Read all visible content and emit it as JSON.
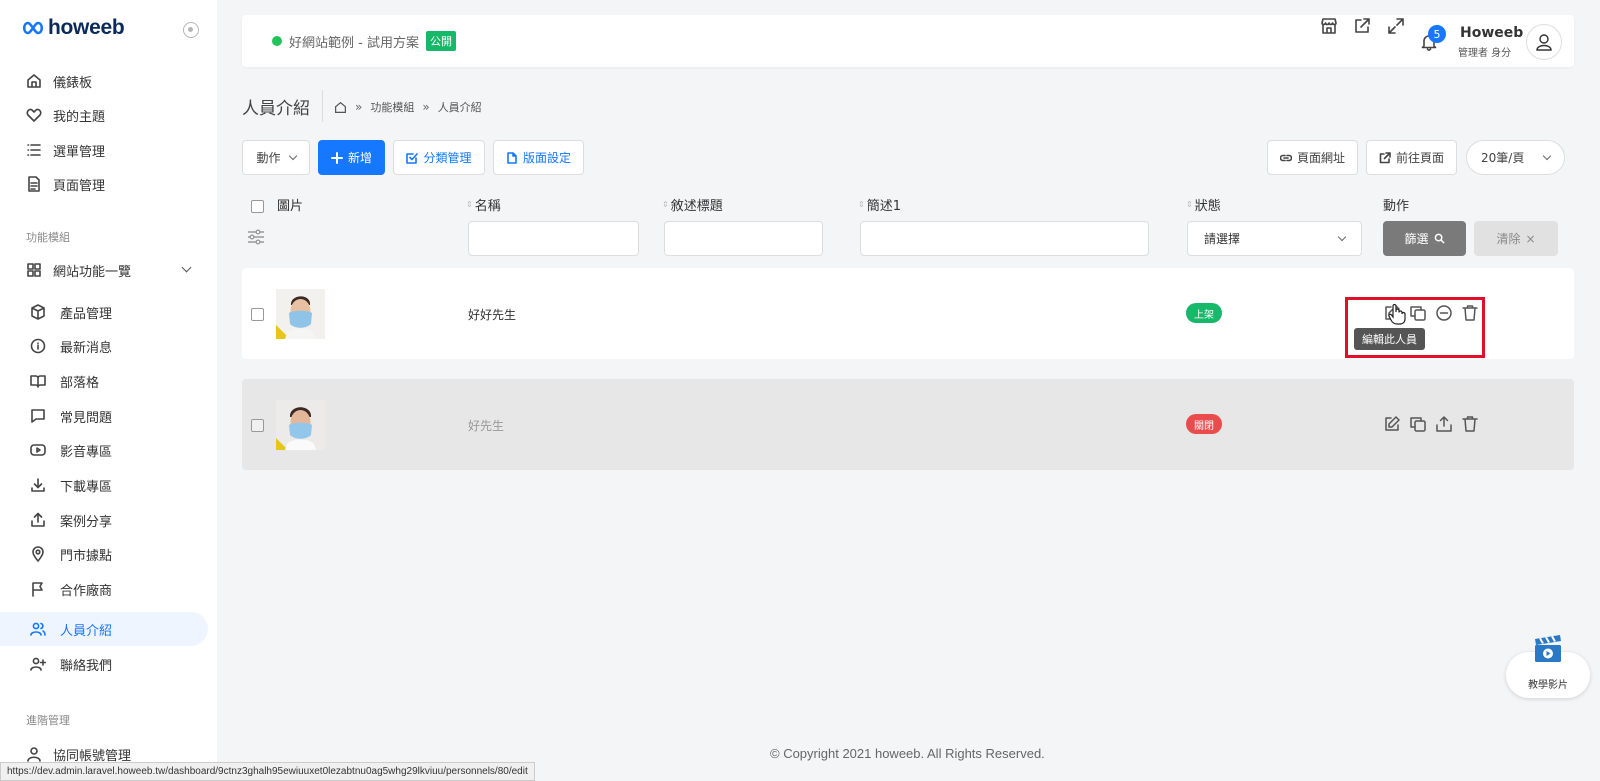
{
  "brand": {
    "logo_text": "howeeb",
    "color": "#0b2a5b"
  },
  "colors": {
    "accent": "#1677ff",
    "success": "#18b86a",
    "danger": "#e84c4c",
    "highlight": "#e0102a"
  },
  "sidebar": {
    "items": [
      {
        "label": "儀錶板",
        "icon": "home-icon"
      },
      {
        "label": "我的主題",
        "icon": "heart-icon"
      },
      {
        "label": "選單管理",
        "icon": "list-icon"
      },
      {
        "label": "頁面管理",
        "icon": "document-icon"
      }
    ],
    "section_modules": "功能模組",
    "group_label": "網站功能一覽",
    "sub_items": [
      {
        "label": "產品管理",
        "icon": "box-icon"
      },
      {
        "label": "最新消息",
        "icon": "info-icon"
      },
      {
        "label": "部落格",
        "icon": "book-icon"
      },
      {
        "label": "常見問題",
        "icon": "chat-icon"
      },
      {
        "label": "影音專區",
        "icon": "video-icon"
      },
      {
        "label": "下載專區",
        "icon": "download-icon"
      },
      {
        "label": "案例分享",
        "icon": "share-icon"
      },
      {
        "label": "門市據點",
        "icon": "map-pin-icon"
      },
      {
        "label": "合作廠商",
        "icon": "flag-icon"
      },
      {
        "label": "人員介紹",
        "icon": "users-icon",
        "active": true
      },
      {
        "label": "聯絡我們",
        "icon": "user-plus-icon"
      }
    ],
    "section_advanced": "進階管理",
    "advanced_items": [
      {
        "label": "協同帳號管理",
        "icon": "user-icon"
      }
    ]
  },
  "header": {
    "site_name": "好網站範例 - 試用方案",
    "public_badge": "公開",
    "notification_count": "5",
    "user_name": "Howeeb",
    "user_role": "管理者 身分"
  },
  "page": {
    "title": "人員介紹",
    "breadcrumb": [
      "功能模組",
      "人員介紹"
    ]
  },
  "toolbar": {
    "action_label": "動作",
    "add_label": "新增",
    "category_label": "分類管理",
    "layout_label": "版面設定",
    "page_url_label": "頁面網址",
    "goto_page_label": "前往頁面",
    "per_page": "20筆/頁"
  },
  "table": {
    "columns": [
      "圖片",
      "名稱",
      "敘述標題",
      "簡述1",
      "狀態",
      "動作"
    ],
    "status_placeholder": "請選擇",
    "filter_label": "篩選",
    "clear_label": "清除",
    "rows": [
      {
        "name": "好好先生",
        "status": "上架",
        "status_color": "#18b86a"
      },
      {
        "name": "好先生",
        "status": "關閉",
        "status_color": "#e84c4c"
      }
    ],
    "tooltip": "編輯此人員"
  },
  "footer": {
    "copyright": "© Copyright 2021 howeeb. All Rights Reserved."
  },
  "statusbar": {
    "url": "https://dev.admin.laravel.howeeb.tw/dashboard/9ctnz3ghalh95ewiuuxet0lezabtnu0ag5whg29lkviuu/personnels/80/edit"
  },
  "tutorial": {
    "label": "教學影片"
  }
}
